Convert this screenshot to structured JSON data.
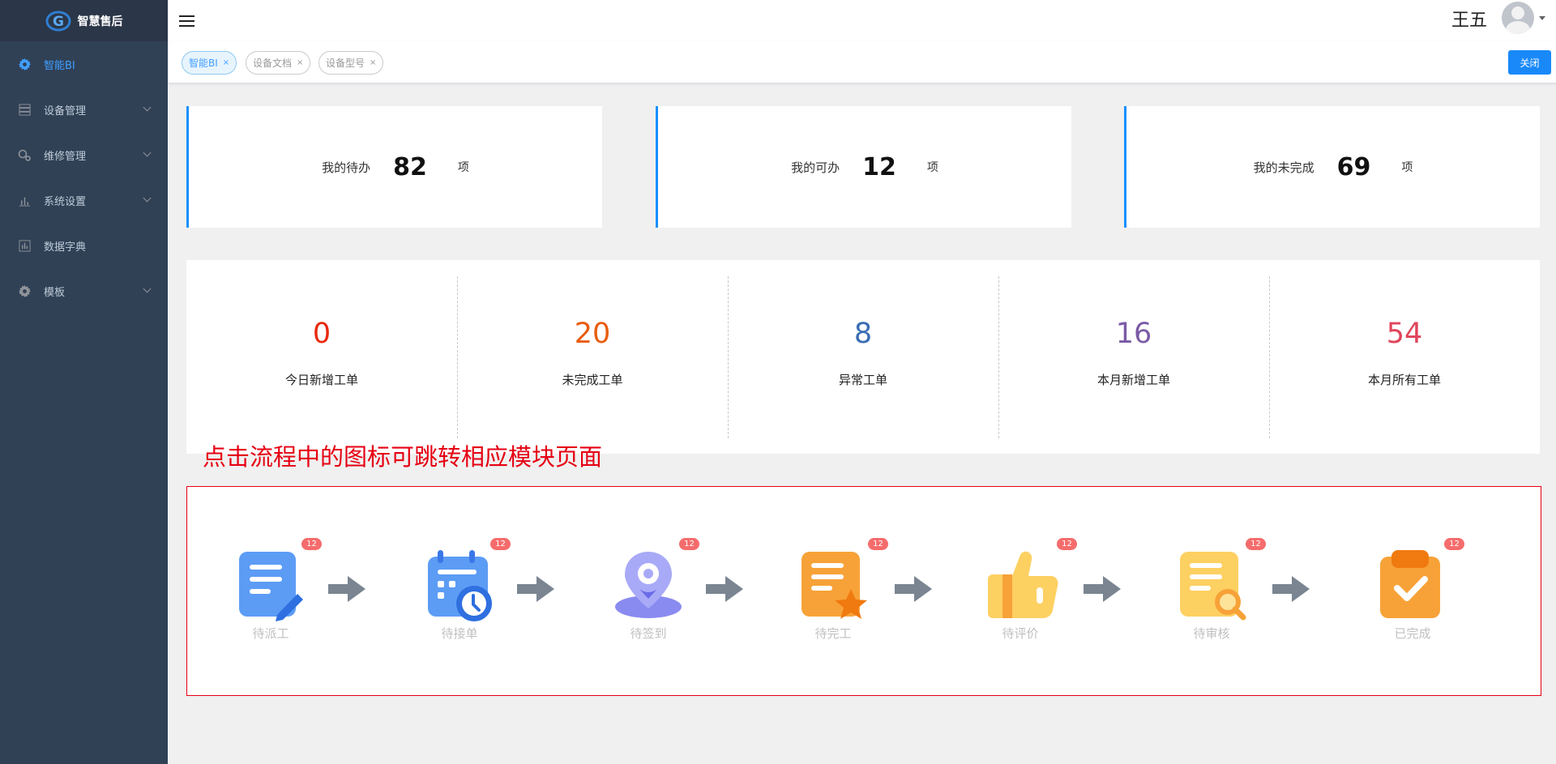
{
  "app": {
    "title": "智慧售后"
  },
  "sidebar": {
    "items": [
      {
        "label": "智能BI",
        "icon": "gear-icon",
        "active": true,
        "expandable": false
      },
      {
        "label": "设备管理",
        "icon": "server-icon",
        "active": false,
        "expandable": true
      },
      {
        "label": "维修管理",
        "icon": "wrench-icon",
        "active": false,
        "expandable": true
      },
      {
        "label": "系统设置",
        "icon": "bar-chart-icon",
        "active": false,
        "expandable": true
      },
      {
        "label": "数据字典",
        "icon": "chart-box-icon",
        "active": false,
        "expandable": false
      },
      {
        "label": "模板",
        "icon": "gear-icon",
        "active": false,
        "expandable": true
      }
    ]
  },
  "header": {
    "user_name": "王五"
  },
  "tags": {
    "items": [
      {
        "label": "智能BI",
        "active": true
      },
      {
        "label": "设备文档",
        "active": false
      },
      {
        "label": "设备型号",
        "active": false
      }
    ],
    "close_label": "关闭"
  },
  "cards": [
    {
      "label": "我的待办",
      "value": "82",
      "unit": "项"
    },
    {
      "label": "我的可办",
      "value": "12",
      "unit": "项"
    },
    {
      "label": "我的未完成",
      "value": "69",
      "unit": "项"
    }
  ],
  "metrics": [
    {
      "value": "0",
      "label": "今日新增工单",
      "color": "#e8290e"
    },
    {
      "value": "20",
      "label": "未完成工单",
      "color": "#e85d0e"
    },
    {
      "value": "8",
      "label": "异常工单",
      "color": "#3a6db5"
    },
    {
      "value": "16",
      "label": "本月新增工单",
      "color": "#7b5aa6"
    },
    {
      "value": "54",
      "label": "本月所有工单",
      "color": "#e0455b"
    }
  ],
  "hint": "点击流程中的图标可跳转相应模块页面",
  "flow": {
    "steps": [
      {
        "label": "待派工",
        "badge": "12",
        "icon": "dispatch-icon"
      },
      {
        "label": "待接单",
        "badge": "12",
        "icon": "calendar-clock-icon"
      },
      {
        "label": "待签到",
        "badge": "12",
        "icon": "location-pin-icon"
      },
      {
        "label": "待完工",
        "badge": "12",
        "icon": "document-star-icon"
      },
      {
        "label": "待评价",
        "badge": "12",
        "icon": "thumbs-up-icon"
      },
      {
        "label": "待审核",
        "badge": "12",
        "icon": "document-search-icon"
      },
      {
        "label": "已完成",
        "badge": "12",
        "icon": "clipboard-check-icon"
      }
    ]
  }
}
